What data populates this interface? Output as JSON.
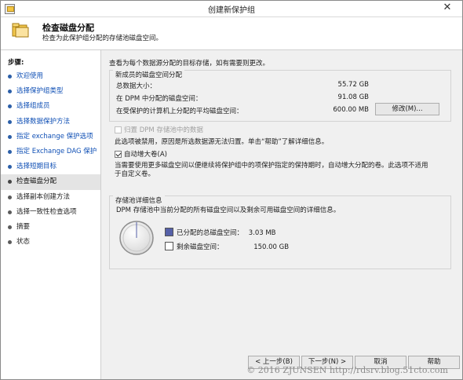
{
  "window": {
    "title": "创建新保护组",
    "close_glyph": "✕"
  },
  "header": {
    "title": "检查磁盘分配",
    "subtitle": "检查为此保护组分配的存储池磁盘空间。",
    "icon": "folder-wizard-icon"
  },
  "steps": {
    "title": "步骤:",
    "items": [
      {
        "label": "欢迎使用",
        "state": "done"
      },
      {
        "label": "选择保护组类型",
        "state": "done"
      },
      {
        "label": "选择组成员",
        "state": "done"
      },
      {
        "label": "选择数据保护方法",
        "state": "done"
      },
      {
        "label": "指定 exchange 保护选项",
        "state": "done"
      },
      {
        "label": "指定 Exchange DAG 保护",
        "state": "done"
      },
      {
        "label": "选择短期目标",
        "state": "done"
      },
      {
        "label": "检查磁盘分配",
        "state": "current"
      },
      {
        "label": "选择副本创建方法",
        "state": "pending"
      },
      {
        "label": "选择一致性检查选项",
        "state": "pending"
      },
      {
        "label": "摘要",
        "state": "pending"
      },
      {
        "label": "状态",
        "state": "pending"
      }
    ]
  },
  "main": {
    "intro": "查看为每个数据源分配的目标存储，如有需要则更改。",
    "allocation": {
      "legend": "新成员的磁盘空间分配",
      "rows": [
        {
          "label": "总数据大小：",
          "value": "55.72 GB"
        },
        {
          "label": "在 DPM 中分配的磁盘空间：",
          "value": "91.08 GB"
        },
        {
          "label": "在受保护的计算机上分配的平均磁盘空间：",
          "value": "600.00 MB"
        }
      ],
      "modify_button": "修改(M)..."
    },
    "colocate": {
      "label": "归置 DPM 存储池中的数据",
      "checked": false,
      "disabled": true,
      "note": "此选项被禁用，原因是所选数据源无法归置。单击“帮助”了解详细信息。"
    },
    "autogrow": {
      "label": "自动增大卷(A)",
      "checked": true,
      "note_line1": "当需要使用更多磁盘空间以便继续将保护组中的项保护指定的保持期时，自动增大分配的卷。此选项不适用",
      "note_line2": "于自定义卷。"
    },
    "pool": {
      "legend": "存储池详细信息",
      "description": "DPM 存储池中当前分配的所有磁盘空间以及剩余可用磁盘空间的详细信息。",
      "allocated": {
        "label": "已分配的总磁盘空间：",
        "value": "3.03 MB",
        "color": "#5560a8"
      },
      "free": {
        "label": "剩余磁盘空间：",
        "value": "150.00 GB",
        "color": "#ffffff"
      }
    }
  },
  "buttons": {
    "back": "< 上一步(B)",
    "next": "下一步(N) >",
    "cancel": "取消",
    "help": "帮助"
  },
  "watermark": "© 2016 ZJUNSEN http://rdsrv.blog.51cto.com"
}
